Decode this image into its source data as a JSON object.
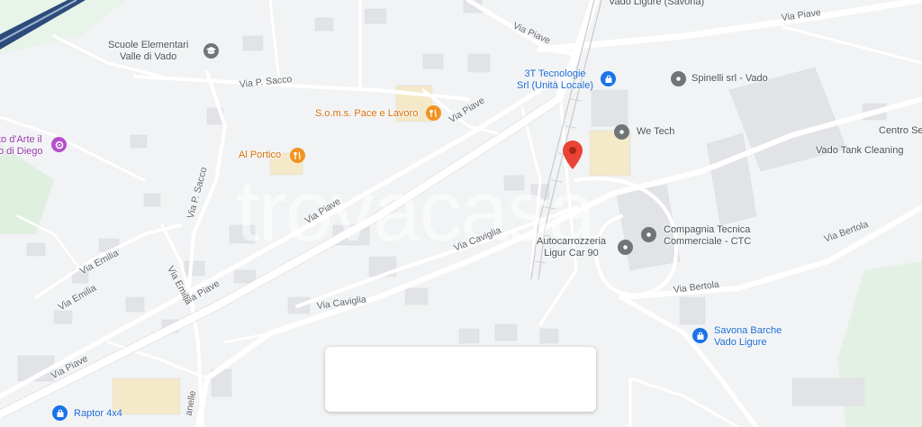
{
  "map": {
    "watermark": "trovacasa",
    "roads": [
      {
        "id": "via-piave-1",
        "label": "Via Piave"
      },
      {
        "id": "via-piave-2",
        "label": "Via Piave"
      },
      {
        "id": "via-piave-3",
        "label": "Via Piave"
      },
      {
        "id": "via-piave-4",
        "label": "Via Piave"
      },
      {
        "id": "via-piave-5",
        "label": "Via Piave"
      },
      {
        "id": "via-p-sacco-1",
        "label": "Via P. Sacco"
      },
      {
        "id": "via-p-sacco-2",
        "label": "Via P. Sacco"
      },
      {
        "id": "via-emilia-1",
        "label": "Via Emilia"
      },
      {
        "id": "via-emilia-2",
        "label": "Via Emilia"
      },
      {
        "id": "via-emilia-3",
        "label": "Via Emilia"
      },
      {
        "id": "via-caviglia-1",
        "label": "Via Caviglia"
      },
      {
        "id": "via-caviglia-2",
        "label": "Via Caviglia"
      },
      {
        "id": "via-bertola-1",
        "label": "Via Bertola"
      },
      {
        "id": "via-bertola-2",
        "label": "Via Bertola"
      },
      {
        "id": "anelle",
        "label": "anelle"
      }
    ],
    "pois": {
      "scuole": "Scuole Elementari\nValle di Vado",
      "arte": "to d'Arte il\no di Diego",
      "soms": "S.o.m.s. Pace e Lavoro",
      "portico": "Al Portico",
      "tecnologie": "3T Tecnologie\nSrl (Unità Locale)",
      "spinelli": "Spinelli srl - Vado",
      "wetech": "We Tech",
      "centro": "Centro Se",
      "tank": "Vado Tank Cleaning",
      "ctc": "Compagnia Tecnica\nCommerciale - CTC",
      "autocarrozzeria": "Autocarrozzeria\nLigur Car 90",
      "savona_barche": "Savona Barche\nVado Ligure",
      "raptor": "Raptor 4x4",
      "station": "Vado Ligure (Savona)"
    },
    "colors": {
      "background": "#f1f3f4",
      "road": "#ffffff",
      "main_road": "#ffffff",
      "building": "#e1e3e6",
      "green": "#dff0e0",
      "highway": "#2d4b7a",
      "marker": "#ea4335",
      "poi_gray": "#707579",
      "poi_orange": "#f29322",
      "poi_blue": "#1a73e8",
      "poi_purple": "#b44fc9"
    }
  },
  "info_card": {}
}
